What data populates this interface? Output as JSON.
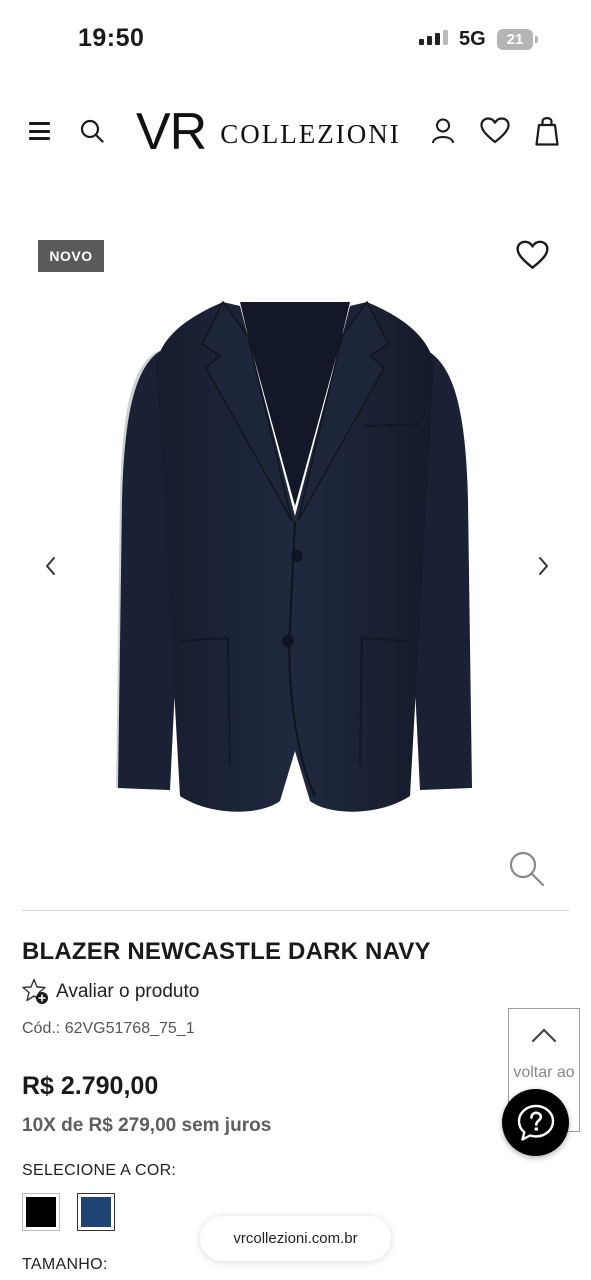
{
  "status_bar": {
    "time": "19:50",
    "network": "5G",
    "battery": "21"
  },
  "header": {
    "logo_mark": "VR",
    "logo_text": "COLLEZIONI",
    "icons": [
      "menu-icon",
      "search-icon",
      "account-icon",
      "heart-icon",
      "bag-icon"
    ]
  },
  "gallery": {
    "badge": "NOVO",
    "icons": [
      "heart-icon",
      "chevron-left-icon",
      "chevron-right-icon",
      "zoom-icon"
    ]
  },
  "product": {
    "title": "BLAZER NEWCASTLE DARK NAVY",
    "rate_label": "Avaliar o produto",
    "code": "Cód.: 62VG51768_75_1",
    "price": "R$ 2.790,00",
    "installments": "10X de R$ 279,00 sem juros",
    "color_label": "SELECIONE A COR:",
    "colors": [
      {
        "name": "black",
        "hex": "#000000"
      },
      {
        "name": "navy",
        "hex": "#1f4373"
      }
    ],
    "size_label": "TAMANHO:"
  },
  "floating": {
    "back_to_top": "voltar ao",
    "help_icon": "question-icon"
  },
  "browser": {
    "url": "vrcollezioni.com.br"
  },
  "colors": {
    "blazer": "#1c2438",
    "badge_bg": "#5a5a5a",
    "text": "#1a1a1a"
  }
}
